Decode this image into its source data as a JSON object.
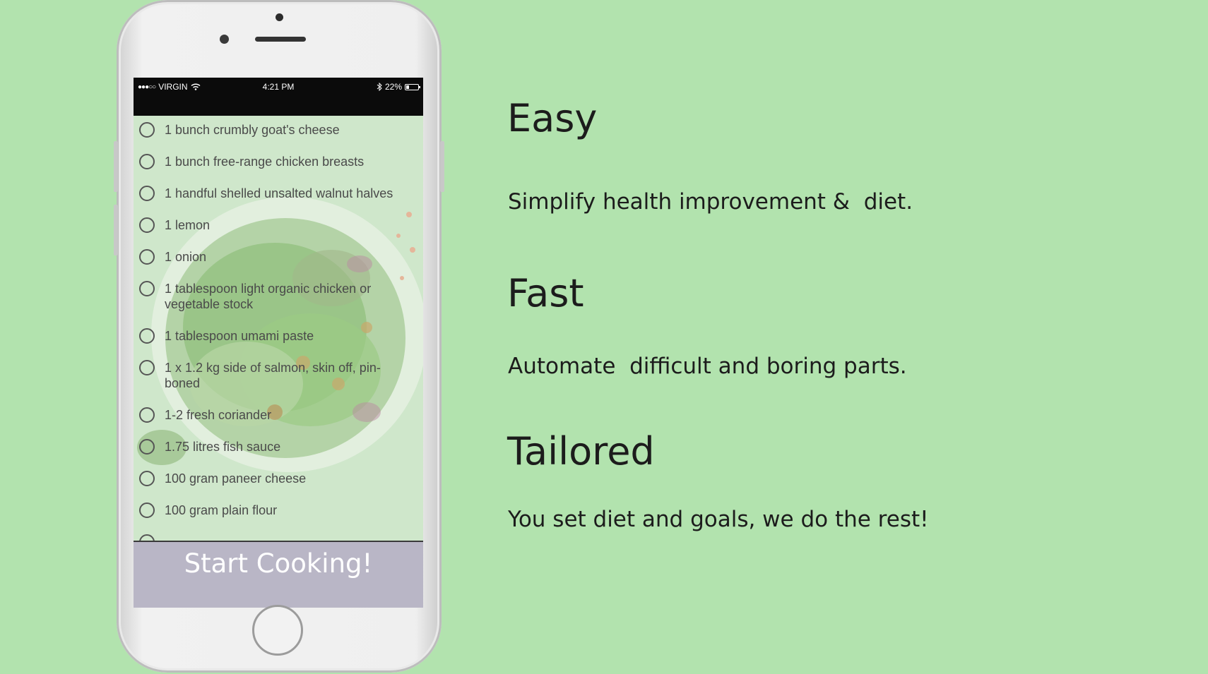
{
  "phone": {
    "status_bar": {
      "signal": "●●●○○",
      "carrier": "VIRGIN",
      "wifi_icon": "wifi-icon",
      "time": "4:21 PM",
      "bluetooth_icon": "bluetooth-icon",
      "battery": "22%",
      "battery_icon": "battery-icon"
    },
    "ingredients": [
      "1 bunch crumbly goat's cheese",
      "1 bunch free-range chicken breasts",
      "1 handful shelled unsalted walnut halves",
      "1 lemon",
      "1 onion",
      "1 tablespoon light organic chicken or vegetable stock",
      "1 tablespoon umami paste",
      "1 x 1.2 kg side of salmon, skin off, pin-boned",
      "1-2 fresh coriander",
      "1.75 litres fish sauce",
      "100 gram paneer cheese",
      "100 gram plain flour"
    ],
    "start_button_label": "Start Cooking!"
  },
  "features": [
    {
      "title": "Easy",
      "description": "Simplify health improvement &  diet."
    },
    {
      "title": "Fast",
      "description": "Automate  difficult and boring parts."
    },
    {
      "title": "Tailored",
      "description": "You set diet and goals, we do the rest!"
    }
  ],
  "colors": {
    "background": "#b2e3ae",
    "button": "#b9b6c6",
    "text": "#1c1c1c"
  }
}
